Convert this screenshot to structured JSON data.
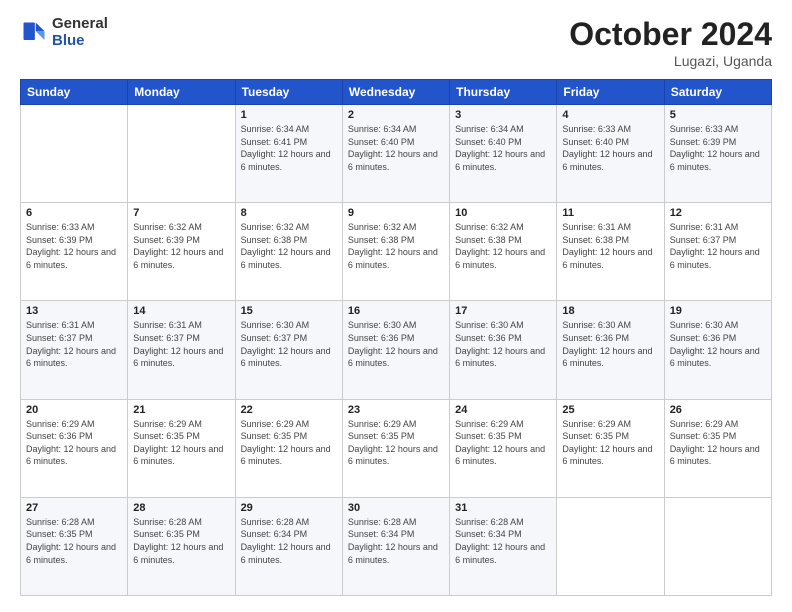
{
  "logo": {
    "general": "General",
    "blue": "Blue"
  },
  "header": {
    "month": "October 2024",
    "location": "Lugazi, Uganda"
  },
  "weekdays": [
    "Sunday",
    "Monday",
    "Tuesday",
    "Wednesday",
    "Thursday",
    "Friday",
    "Saturday"
  ],
  "weeks": [
    [
      {
        "day": "",
        "info": ""
      },
      {
        "day": "",
        "info": ""
      },
      {
        "day": "1",
        "sunrise": "Sunrise: 6:34 AM",
        "sunset": "Sunset: 6:41 PM",
        "daylight": "Daylight: 12 hours and 6 minutes."
      },
      {
        "day": "2",
        "sunrise": "Sunrise: 6:34 AM",
        "sunset": "Sunset: 6:40 PM",
        "daylight": "Daylight: 12 hours and 6 minutes."
      },
      {
        "day": "3",
        "sunrise": "Sunrise: 6:34 AM",
        "sunset": "Sunset: 6:40 PM",
        "daylight": "Daylight: 12 hours and 6 minutes."
      },
      {
        "day": "4",
        "sunrise": "Sunrise: 6:33 AM",
        "sunset": "Sunset: 6:40 PM",
        "daylight": "Daylight: 12 hours and 6 minutes."
      },
      {
        "day": "5",
        "sunrise": "Sunrise: 6:33 AM",
        "sunset": "Sunset: 6:39 PM",
        "daylight": "Daylight: 12 hours and 6 minutes."
      }
    ],
    [
      {
        "day": "6",
        "sunrise": "Sunrise: 6:33 AM",
        "sunset": "Sunset: 6:39 PM",
        "daylight": "Daylight: 12 hours and 6 minutes."
      },
      {
        "day": "7",
        "sunrise": "Sunrise: 6:32 AM",
        "sunset": "Sunset: 6:39 PM",
        "daylight": "Daylight: 12 hours and 6 minutes."
      },
      {
        "day": "8",
        "sunrise": "Sunrise: 6:32 AM",
        "sunset": "Sunset: 6:38 PM",
        "daylight": "Daylight: 12 hours and 6 minutes."
      },
      {
        "day": "9",
        "sunrise": "Sunrise: 6:32 AM",
        "sunset": "Sunset: 6:38 PM",
        "daylight": "Daylight: 12 hours and 6 minutes."
      },
      {
        "day": "10",
        "sunrise": "Sunrise: 6:32 AM",
        "sunset": "Sunset: 6:38 PM",
        "daylight": "Daylight: 12 hours and 6 minutes."
      },
      {
        "day": "11",
        "sunrise": "Sunrise: 6:31 AM",
        "sunset": "Sunset: 6:38 PM",
        "daylight": "Daylight: 12 hours and 6 minutes."
      },
      {
        "day": "12",
        "sunrise": "Sunrise: 6:31 AM",
        "sunset": "Sunset: 6:37 PM",
        "daylight": "Daylight: 12 hours and 6 minutes."
      }
    ],
    [
      {
        "day": "13",
        "sunrise": "Sunrise: 6:31 AM",
        "sunset": "Sunset: 6:37 PM",
        "daylight": "Daylight: 12 hours and 6 minutes."
      },
      {
        "day": "14",
        "sunrise": "Sunrise: 6:31 AM",
        "sunset": "Sunset: 6:37 PM",
        "daylight": "Daylight: 12 hours and 6 minutes."
      },
      {
        "day": "15",
        "sunrise": "Sunrise: 6:30 AM",
        "sunset": "Sunset: 6:37 PM",
        "daylight": "Daylight: 12 hours and 6 minutes."
      },
      {
        "day": "16",
        "sunrise": "Sunrise: 6:30 AM",
        "sunset": "Sunset: 6:36 PM",
        "daylight": "Daylight: 12 hours and 6 minutes."
      },
      {
        "day": "17",
        "sunrise": "Sunrise: 6:30 AM",
        "sunset": "Sunset: 6:36 PM",
        "daylight": "Daylight: 12 hours and 6 minutes."
      },
      {
        "day": "18",
        "sunrise": "Sunrise: 6:30 AM",
        "sunset": "Sunset: 6:36 PM",
        "daylight": "Daylight: 12 hours and 6 minutes."
      },
      {
        "day": "19",
        "sunrise": "Sunrise: 6:30 AM",
        "sunset": "Sunset: 6:36 PM",
        "daylight": "Daylight: 12 hours and 6 minutes."
      }
    ],
    [
      {
        "day": "20",
        "sunrise": "Sunrise: 6:29 AM",
        "sunset": "Sunset: 6:36 PM",
        "daylight": "Daylight: 12 hours and 6 minutes."
      },
      {
        "day": "21",
        "sunrise": "Sunrise: 6:29 AM",
        "sunset": "Sunset: 6:35 PM",
        "daylight": "Daylight: 12 hours and 6 minutes."
      },
      {
        "day": "22",
        "sunrise": "Sunrise: 6:29 AM",
        "sunset": "Sunset: 6:35 PM",
        "daylight": "Daylight: 12 hours and 6 minutes."
      },
      {
        "day": "23",
        "sunrise": "Sunrise: 6:29 AM",
        "sunset": "Sunset: 6:35 PM",
        "daylight": "Daylight: 12 hours and 6 minutes."
      },
      {
        "day": "24",
        "sunrise": "Sunrise: 6:29 AM",
        "sunset": "Sunset: 6:35 PM",
        "daylight": "Daylight: 12 hours and 6 minutes."
      },
      {
        "day": "25",
        "sunrise": "Sunrise: 6:29 AM",
        "sunset": "Sunset: 6:35 PM",
        "daylight": "Daylight: 12 hours and 6 minutes."
      },
      {
        "day": "26",
        "sunrise": "Sunrise: 6:29 AM",
        "sunset": "Sunset: 6:35 PM",
        "daylight": "Daylight: 12 hours and 6 minutes."
      }
    ],
    [
      {
        "day": "27",
        "sunrise": "Sunrise: 6:28 AM",
        "sunset": "Sunset: 6:35 PM",
        "daylight": "Daylight: 12 hours and 6 minutes."
      },
      {
        "day": "28",
        "sunrise": "Sunrise: 6:28 AM",
        "sunset": "Sunset: 6:35 PM",
        "daylight": "Daylight: 12 hours and 6 minutes."
      },
      {
        "day": "29",
        "sunrise": "Sunrise: 6:28 AM",
        "sunset": "Sunset: 6:34 PM",
        "daylight": "Daylight: 12 hours and 6 minutes."
      },
      {
        "day": "30",
        "sunrise": "Sunrise: 6:28 AM",
        "sunset": "Sunset: 6:34 PM",
        "daylight": "Daylight: 12 hours and 6 minutes."
      },
      {
        "day": "31",
        "sunrise": "Sunrise: 6:28 AM",
        "sunset": "Sunset: 6:34 PM",
        "daylight": "Daylight: 12 hours and 6 minutes."
      },
      {
        "day": "",
        "info": ""
      },
      {
        "day": "",
        "info": ""
      }
    ]
  ]
}
